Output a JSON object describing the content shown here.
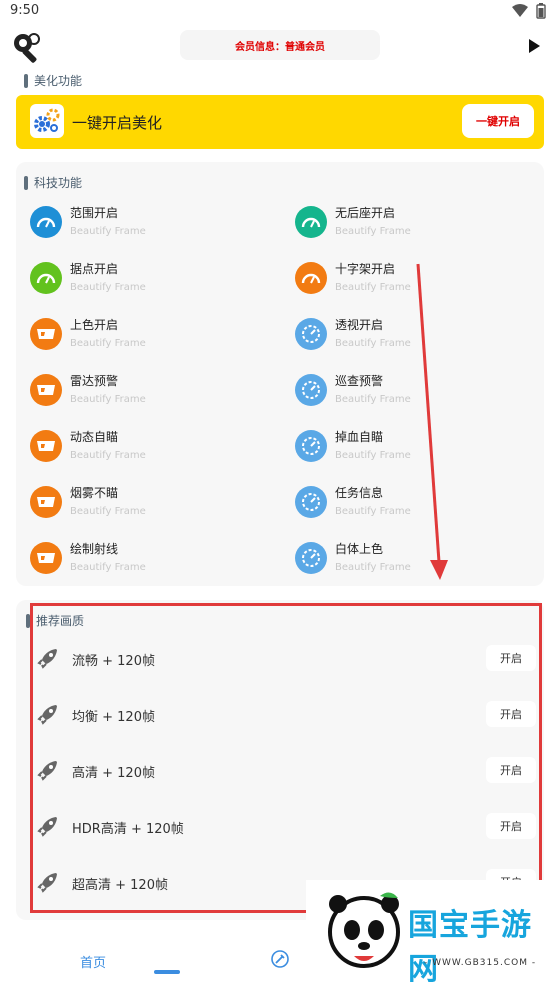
{
  "status": {
    "time": "9:50"
  },
  "header": {
    "member_info": "会员信息：普通会员"
  },
  "beautify": {
    "section_title": "美化功能",
    "one_key_label": "一键开启美化",
    "one_key_button": "一键开启"
  },
  "tech": {
    "section_title": "科技功能",
    "items": [
      {
        "name": "范围开启",
        "sub": "Beautify Frame",
        "color": "#1e8fd6",
        "icon": "gauge-icon"
      },
      {
        "name": "无后座开启",
        "sub": "Beautify Frame",
        "color": "#15b58d",
        "icon": "gauge-icon"
      },
      {
        "name": "据点开启",
        "sub": "Beautify Frame",
        "color": "#62c21e",
        "icon": "gauge-icon"
      },
      {
        "name": "十字架开启",
        "sub": "Beautify Frame",
        "color": "#f27b12",
        "icon": "gauge-icon"
      },
      {
        "name": "上色开启",
        "sub": "Beautify Frame",
        "color": "#f27b12",
        "icon": "glasses-icon"
      },
      {
        "name": "透视开启",
        "sub": "Beautify Frame",
        "color": "#5aa8e6",
        "icon": "speedometer-icon"
      },
      {
        "name": "雷达预警",
        "sub": "Beautify Frame",
        "color": "#f27b12",
        "icon": "glasses-icon"
      },
      {
        "name": "巡查预警",
        "sub": "Beautify Frame",
        "color": "#5aa8e6",
        "icon": "speedometer-icon"
      },
      {
        "name": "动态自瞄",
        "sub": "Beautify Frame",
        "color": "#f27b12",
        "icon": "glasses-icon"
      },
      {
        "name": "掉血自瞄",
        "sub": "Beautify Frame",
        "color": "#5aa8e6",
        "icon": "speedometer-icon"
      },
      {
        "name": "烟雾不瞄",
        "sub": "Beautify Frame",
        "color": "#f27b12",
        "icon": "glasses-icon"
      },
      {
        "name": "任务信息",
        "sub": "Beautify Frame",
        "color": "#5aa8e6",
        "icon": "speedometer-icon"
      },
      {
        "name": "绘制射线",
        "sub": "Beautify Frame",
        "color": "#f27b12",
        "icon": "glasses-icon"
      },
      {
        "name": "白体上色",
        "sub": "Beautify Frame",
        "color": "#5aa8e6",
        "icon": "speedometer-icon"
      }
    ]
  },
  "recommended": {
    "section_title": "推荐画质",
    "items": [
      {
        "label": "流畅 + 120帧",
        "button": "开启"
      },
      {
        "label": "均衡 + 120帧",
        "button": "开启"
      },
      {
        "label": "高清 + 120帧",
        "button": "开启"
      },
      {
        "label": "HDR高清 + 120帧",
        "button": "开启"
      },
      {
        "label": "超高清 + 120帧",
        "button": "开启"
      }
    ]
  },
  "nav": {
    "home": "首页"
  },
  "watermark": {
    "name": "国宝手游网",
    "url": "- WWW.GB315.COM -"
  },
  "colors": {
    "accent": "#3b8de0",
    "highlight": "#ffd800",
    "annotation_red": "#e03a3a",
    "member_red": "#e00000"
  }
}
